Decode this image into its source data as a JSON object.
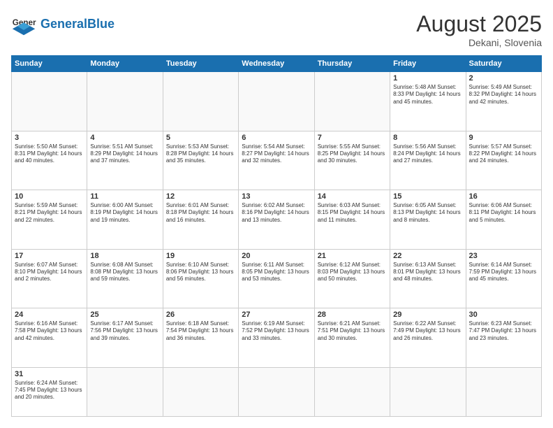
{
  "header": {
    "logo_general": "General",
    "logo_blue": "Blue",
    "month_year": "August 2025",
    "location": "Dekani, Slovenia"
  },
  "weekdays": [
    "Sunday",
    "Monday",
    "Tuesday",
    "Wednesday",
    "Thursday",
    "Friday",
    "Saturday"
  ],
  "weeks": [
    [
      {
        "day": "",
        "info": ""
      },
      {
        "day": "",
        "info": ""
      },
      {
        "day": "",
        "info": ""
      },
      {
        "day": "",
        "info": ""
      },
      {
        "day": "",
        "info": ""
      },
      {
        "day": "1",
        "info": "Sunrise: 5:48 AM\nSunset: 8:33 PM\nDaylight: 14 hours\nand 45 minutes."
      },
      {
        "day": "2",
        "info": "Sunrise: 5:49 AM\nSunset: 8:32 PM\nDaylight: 14 hours\nand 42 minutes."
      }
    ],
    [
      {
        "day": "3",
        "info": "Sunrise: 5:50 AM\nSunset: 8:31 PM\nDaylight: 14 hours\nand 40 minutes."
      },
      {
        "day": "4",
        "info": "Sunrise: 5:51 AM\nSunset: 8:29 PM\nDaylight: 14 hours\nand 37 minutes."
      },
      {
        "day": "5",
        "info": "Sunrise: 5:53 AM\nSunset: 8:28 PM\nDaylight: 14 hours\nand 35 minutes."
      },
      {
        "day": "6",
        "info": "Sunrise: 5:54 AM\nSunset: 8:27 PM\nDaylight: 14 hours\nand 32 minutes."
      },
      {
        "day": "7",
        "info": "Sunrise: 5:55 AM\nSunset: 8:25 PM\nDaylight: 14 hours\nand 30 minutes."
      },
      {
        "day": "8",
        "info": "Sunrise: 5:56 AM\nSunset: 8:24 PM\nDaylight: 14 hours\nand 27 minutes."
      },
      {
        "day": "9",
        "info": "Sunrise: 5:57 AM\nSunset: 8:22 PM\nDaylight: 14 hours\nand 24 minutes."
      }
    ],
    [
      {
        "day": "10",
        "info": "Sunrise: 5:59 AM\nSunset: 8:21 PM\nDaylight: 14 hours\nand 22 minutes."
      },
      {
        "day": "11",
        "info": "Sunrise: 6:00 AM\nSunset: 8:19 PM\nDaylight: 14 hours\nand 19 minutes."
      },
      {
        "day": "12",
        "info": "Sunrise: 6:01 AM\nSunset: 8:18 PM\nDaylight: 14 hours\nand 16 minutes."
      },
      {
        "day": "13",
        "info": "Sunrise: 6:02 AM\nSunset: 8:16 PM\nDaylight: 14 hours\nand 13 minutes."
      },
      {
        "day": "14",
        "info": "Sunrise: 6:03 AM\nSunset: 8:15 PM\nDaylight: 14 hours\nand 11 minutes."
      },
      {
        "day": "15",
        "info": "Sunrise: 6:05 AM\nSunset: 8:13 PM\nDaylight: 14 hours\nand 8 minutes."
      },
      {
        "day": "16",
        "info": "Sunrise: 6:06 AM\nSunset: 8:11 PM\nDaylight: 14 hours\nand 5 minutes."
      }
    ],
    [
      {
        "day": "17",
        "info": "Sunrise: 6:07 AM\nSunset: 8:10 PM\nDaylight: 14 hours\nand 2 minutes."
      },
      {
        "day": "18",
        "info": "Sunrise: 6:08 AM\nSunset: 8:08 PM\nDaylight: 13 hours\nand 59 minutes."
      },
      {
        "day": "19",
        "info": "Sunrise: 6:10 AM\nSunset: 8:06 PM\nDaylight: 13 hours\nand 56 minutes."
      },
      {
        "day": "20",
        "info": "Sunrise: 6:11 AM\nSunset: 8:05 PM\nDaylight: 13 hours\nand 53 minutes."
      },
      {
        "day": "21",
        "info": "Sunrise: 6:12 AM\nSunset: 8:03 PM\nDaylight: 13 hours\nand 50 minutes."
      },
      {
        "day": "22",
        "info": "Sunrise: 6:13 AM\nSunset: 8:01 PM\nDaylight: 13 hours\nand 48 minutes."
      },
      {
        "day": "23",
        "info": "Sunrise: 6:14 AM\nSunset: 7:59 PM\nDaylight: 13 hours\nand 45 minutes."
      }
    ],
    [
      {
        "day": "24",
        "info": "Sunrise: 6:16 AM\nSunset: 7:58 PM\nDaylight: 13 hours\nand 42 minutes."
      },
      {
        "day": "25",
        "info": "Sunrise: 6:17 AM\nSunset: 7:56 PM\nDaylight: 13 hours\nand 39 minutes."
      },
      {
        "day": "26",
        "info": "Sunrise: 6:18 AM\nSunset: 7:54 PM\nDaylight: 13 hours\nand 36 minutes."
      },
      {
        "day": "27",
        "info": "Sunrise: 6:19 AM\nSunset: 7:52 PM\nDaylight: 13 hours\nand 33 minutes."
      },
      {
        "day": "28",
        "info": "Sunrise: 6:21 AM\nSunset: 7:51 PM\nDaylight: 13 hours\nand 30 minutes."
      },
      {
        "day": "29",
        "info": "Sunrise: 6:22 AM\nSunset: 7:49 PM\nDaylight: 13 hours\nand 26 minutes."
      },
      {
        "day": "30",
        "info": "Sunrise: 6:23 AM\nSunset: 7:47 PM\nDaylight: 13 hours\nand 23 minutes."
      }
    ],
    [
      {
        "day": "31",
        "info": "Sunrise: 6:24 AM\nSunset: 7:45 PM\nDaylight: 13 hours\nand 20 minutes."
      },
      {
        "day": "",
        "info": ""
      },
      {
        "day": "",
        "info": ""
      },
      {
        "day": "",
        "info": ""
      },
      {
        "day": "",
        "info": ""
      },
      {
        "day": "",
        "info": ""
      },
      {
        "day": "",
        "info": ""
      }
    ]
  ]
}
